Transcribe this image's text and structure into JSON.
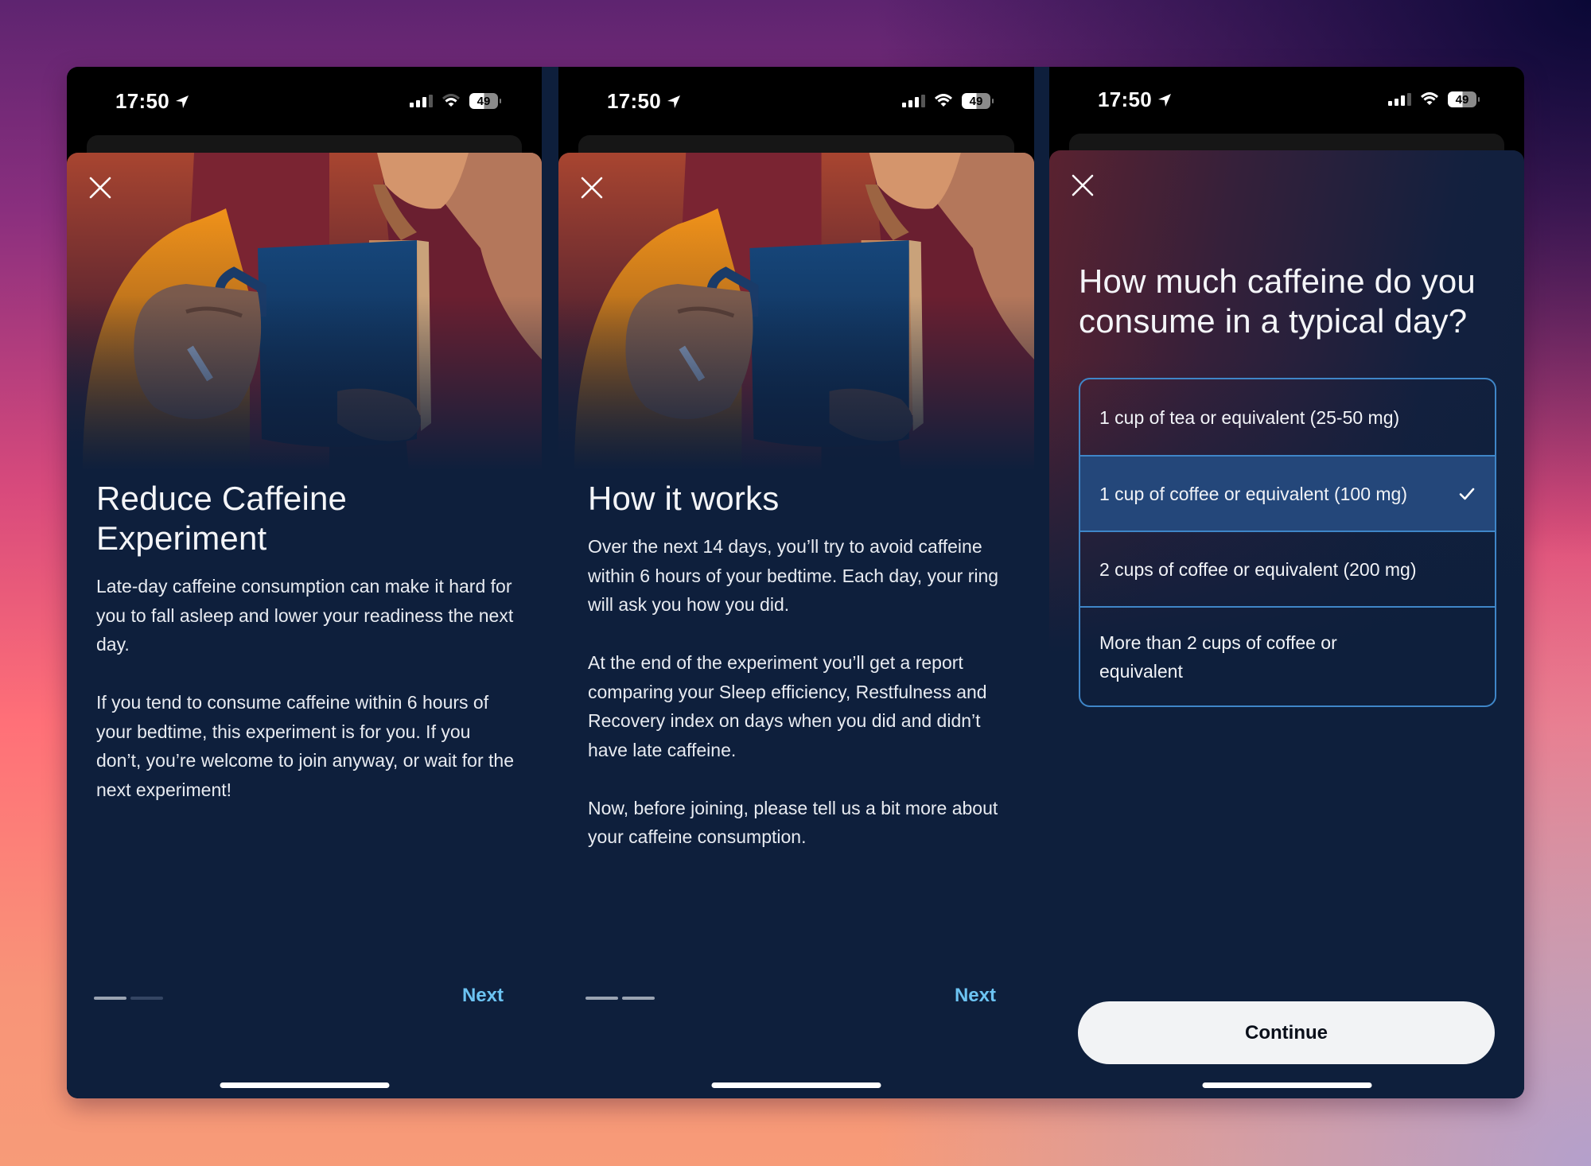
{
  "status_bar": {
    "time": "17:50",
    "battery": "49",
    "icons": [
      "location-arrow-icon",
      "signal-icon",
      "wifi-icon",
      "battery-icon"
    ]
  },
  "screens": [
    {
      "close_icon": "close-icon",
      "illustration": "woman-holding-mug-illustration",
      "title": "Reduce Caffeine Experiment",
      "paragraphs": [
        "Late-day caffeine consumption can make it hard for you to fall asleep and lower your readiness the next day.",
        "If you tend to consume caffeine within 6 hours of your bedtime, this experiment is for you. If you don’t, you’re welcome to join anyway, or wait for the next experiment!"
      ],
      "pager": {
        "current": 1,
        "total": 2
      },
      "next_label": "Next"
    },
    {
      "close_icon": "close-icon",
      "illustration": "woman-holding-mug-illustration",
      "title": "How it works",
      "paragraphs": [
        "Over the next 14 days, you’ll try to avoid caffeine within 6 hours of your bedtime. Each day, your ring will ask you how you did.",
        "At the end of the experiment you’ll get a report comparing your Sleep efficiency, Restfulness and Recovery index on days when you did and didn’t have late caffeine.",
        "Now, before joining, please tell us a bit more about your caffeine consumption."
      ],
      "pager": {
        "current": 2,
        "total": 2
      },
      "next_label": "Next"
    },
    {
      "close_icon": "close-icon",
      "title": "How much caffeine do you consume in a typical day?",
      "options": [
        {
          "label": "1 cup of tea or equivalent (25-50 mg)",
          "selected": false
        },
        {
          "label": "1 cup of coffee or equivalent (100 mg)",
          "selected": true
        },
        {
          "label": "2 cups of coffee or equivalent (200 mg)",
          "selected": false
        },
        {
          "label": "More than 2 cups of coffee or equivalent",
          "selected": false
        }
      ],
      "continue_label": "Continue"
    }
  ],
  "colors": {
    "background_navy": "#0e1f3c",
    "link_blue": "#6cc3f2",
    "option_border": "#3f86c8",
    "option_selected": "#24477a",
    "button_bg": "#f2f3f5"
  }
}
